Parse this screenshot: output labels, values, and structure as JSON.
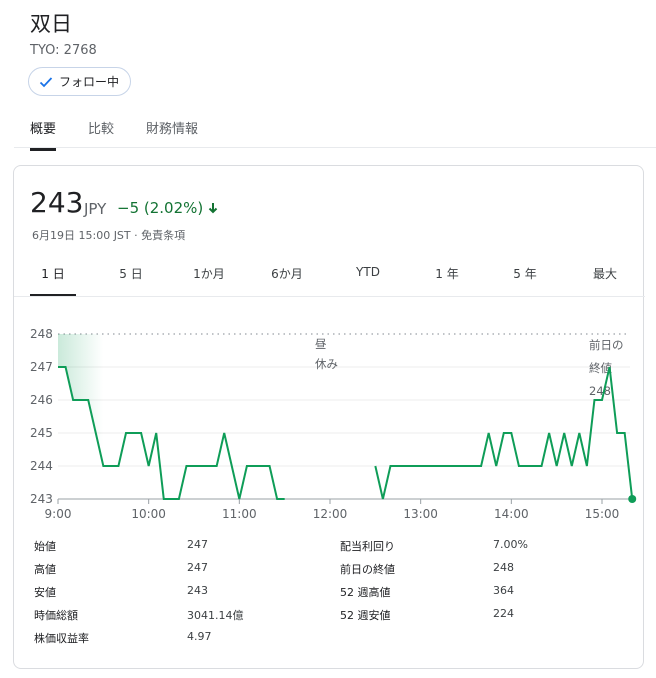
{
  "header": {
    "company": "双日",
    "ticker": "TYO: 2768",
    "follow_label": "フォロー中"
  },
  "tabs": [
    {
      "label": "概要",
      "active": true
    },
    {
      "label": "比較",
      "active": false
    },
    {
      "label": "財務情報",
      "active": false
    }
  ],
  "quote": {
    "price": "243",
    "currency": "JPY",
    "change": "−5 (2.02%)",
    "meta": "6月19日 15:00 JST · 免責条項"
  },
  "ranges": [
    {
      "label": "1 日",
      "active": true
    },
    {
      "label": "5 日",
      "active": false
    },
    {
      "label": "1か月",
      "active": false
    },
    {
      "label": "6か月",
      "active": false
    },
    {
      "label": "YTD",
      "active": false
    },
    {
      "label": "1 年",
      "active": false
    },
    {
      "label": "5 年",
      "active": false
    },
    {
      "label": "最大",
      "active": false
    }
  ],
  "chart_data": {
    "type": "line",
    "ylim": [
      243,
      248
    ],
    "yticks": [
      "248",
      "247",
      "246",
      "245",
      "244",
      "243"
    ],
    "xticks": [
      "9:00",
      "10:00",
      "11:00",
      "12:00",
      "13:00",
      "14:00",
      "15:00"
    ],
    "xlim": [
      "9:00",
      "15:00"
    ],
    "grid": true,
    "line_color": "#0f9d58",
    "reference": {
      "value": 248,
      "label_lines": [
        "前日の",
        "終値",
        "248"
      ]
    },
    "break_label_lines": [
      "昼",
      "休み"
    ],
    "segments": [
      [
        [
          "9:00",
          247
        ],
        [
          "9:05",
          247
        ],
        [
          "9:10",
          246
        ],
        [
          "9:20",
          246
        ],
        [
          "9:30",
          244
        ],
        [
          "9:40",
          244
        ],
        [
          "9:45",
          245
        ],
        [
          "9:55",
          245
        ],
        [
          "10:00",
          244
        ],
        [
          "10:05",
          245
        ],
        [
          "10:10",
          243
        ],
        [
          "10:20",
          243
        ],
        [
          "10:25",
          244
        ],
        [
          "10:45",
          244
        ],
        [
          "10:50",
          245
        ],
        [
          "11:00",
          243
        ],
        [
          "11:05",
          244
        ],
        [
          "11:20",
          244
        ],
        [
          "11:25",
          243
        ],
        [
          "11:30",
          243
        ]
      ],
      [
        [
          "12:30",
          244
        ],
        [
          "12:35",
          243
        ],
        [
          "12:40",
          244
        ],
        [
          "13:40",
          244
        ],
        [
          "13:45",
          245
        ],
        [
          "13:50",
          244
        ],
        [
          "13:55",
          245
        ],
        [
          "14:00",
          245
        ],
        [
          "14:05",
          244
        ],
        [
          "14:20",
          244
        ],
        [
          "14:25",
          245
        ],
        [
          "14:30",
          244
        ],
        [
          "14:35",
          245
        ],
        [
          "14:40",
          244
        ],
        [
          "14:45",
          245
        ],
        [
          "14:50",
          244
        ],
        [
          "14:55",
          246
        ],
        [
          "15:00",
          246
        ],
        [
          "15:05",
          247
        ],
        [
          "15:10",
          245
        ],
        [
          "15:15",
          245
        ],
        [
          "15:20",
          243
        ]
      ]
    ]
  },
  "stats": {
    "left": [
      {
        "label": "始値",
        "value": "247"
      },
      {
        "label": "高値",
        "value": "247"
      },
      {
        "label": "安値",
        "value": "243"
      },
      {
        "label": "時価総額",
        "value": "3041.14億"
      },
      {
        "label": "株価収益率",
        "value": "4.97"
      }
    ],
    "right": [
      {
        "label": "配当利回り",
        "value": "7.00%"
      },
      {
        "label": "前日の終値",
        "value": "248"
      },
      {
        "label": "52 週高値",
        "value": "364"
      },
      {
        "label": "52 週安値",
        "value": "224"
      }
    ]
  }
}
